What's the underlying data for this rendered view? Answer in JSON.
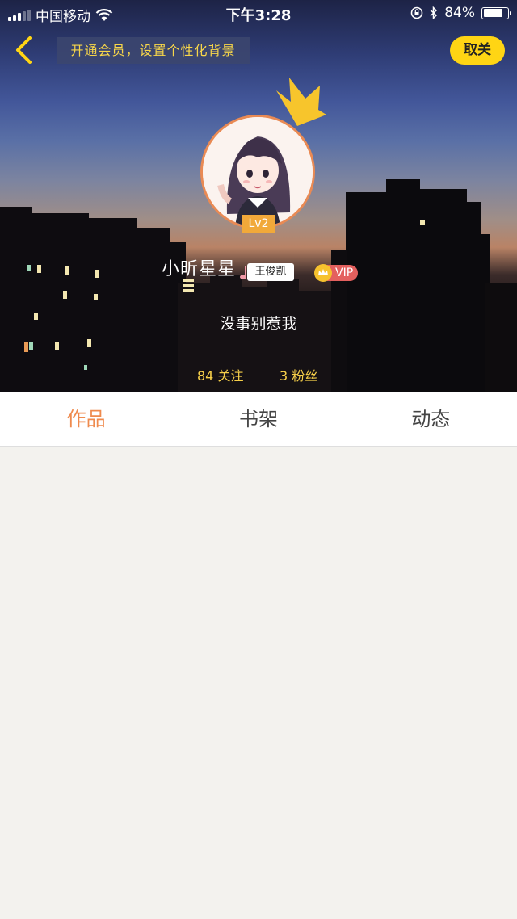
{
  "status_bar": {
    "carrier": "中国移动",
    "time": "下午3:28",
    "battery_percent": "84%",
    "battery_level": 0.84,
    "icons": [
      "signal-icon",
      "wifi-icon",
      "lock-rotation-icon",
      "bluetooth-icon",
      "battery-icon"
    ]
  },
  "nav": {
    "back_icon": "chevron-left-icon",
    "promo_text": "开通会员，设置个性化背景",
    "unfollow_label": "取关"
  },
  "profile": {
    "level": "Lv2",
    "name": "小昕星星",
    "idol_tag": "王俊凯",
    "vip_label": "VIP",
    "signature": "没事别惹我",
    "following": "84 关注",
    "fans": "3 粉丝"
  },
  "tabs": [
    {
      "label": "作品",
      "active": true
    },
    {
      "label": "书架",
      "active": false
    },
    {
      "label": "动态",
      "active": false
    }
  ],
  "colors": {
    "accent": "#ef8a4d",
    "highlight_yellow": "#ffd514",
    "stat_yellow": "#f7d04a",
    "vip_red": "#e4605e",
    "content_bg": "#f3f2ee"
  }
}
